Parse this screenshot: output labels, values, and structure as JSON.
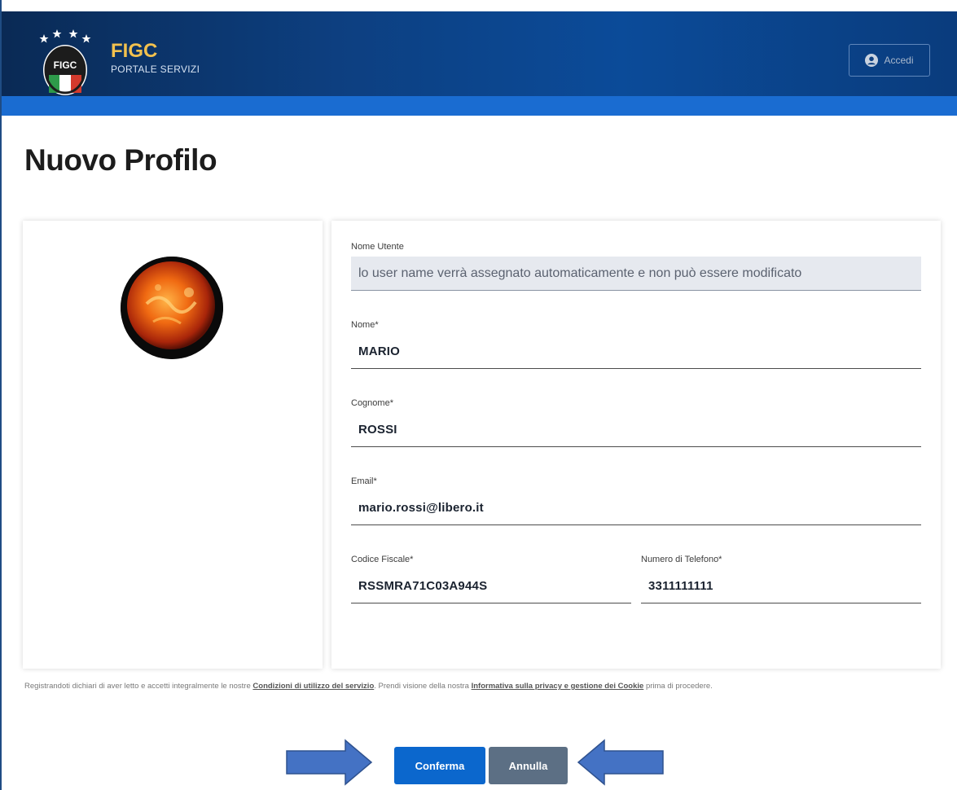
{
  "header": {
    "brand_name": "FIGC",
    "brand_subtitle": "PORTALE SERVIZI",
    "logo_text": "FIGC",
    "login_label": "Accedi"
  },
  "page": {
    "title": "Nuovo Profilo"
  },
  "form": {
    "username": {
      "label": "Nome Utente",
      "placeholder": "lo user name verrà assegnato automaticamente e non può essere modificato"
    },
    "nome": {
      "label": "Nome*",
      "value": "MARIO"
    },
    "cognome": {
      "label": "Cognome*",
      "value": "ROSSI"
    },
    "email": {
      "label": "Email*",
      "value": "mario.rossi@libero.it"
    },
    "codice_fiscale": {
      "label": "Codice Fiscale*",
      "value": "RSSMRA71C03A944S"
    },
    "telefono": {
      "label": "Numero di Telefono*",
      "value": "3311111111"
    }
  },
  "legal": {
    "text_1": "Registrandoti dichiari di aver letto e accetti integralmente le nostre ",
    "link_terms": "Condizioni di utilizzo del servizio",
    "text_2": ". Prendi visione della nostra ",
    "link_privacy": "Informativa sulla privacy e gestione dei Cookie",
    "text_3": " prima di procedere."
  },
  "actions": {
    "confirm_label": "Conferma",
    "cancel_label": "Annulla"
  },
  "colors": {
    "header": "#0d3f80",
    "header_strip": "#1a6cd1",
    "primary": "#0b67cd",
    "secondary": "#5c6f84",
    "arrow": "#4472c4",
    "brand_gold": "#f2c14e"
  },
  "icons": {
    "logo": "figc-shield-logo",
    "login": "user-icon",
    "arrow_left": "arrow-right-icon",
    "arrow_right": "arrow-left-icon"
  }
}
